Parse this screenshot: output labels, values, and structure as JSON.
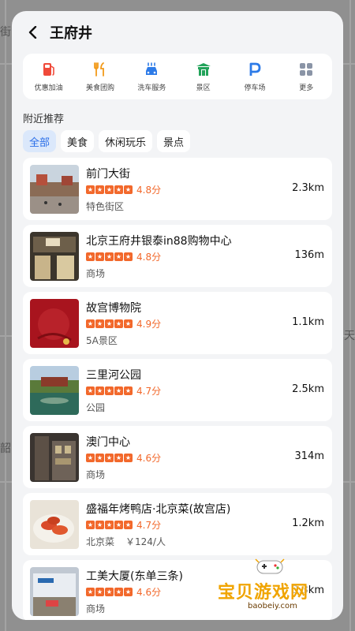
{
  "header": {
    "title": "王府井"
  },
  "services": [
    {
      "label": "优惠加油",
      "icon": "gas-station-icon"
    },
    {
      "label": "美食团购",
      "icon": "utensils-icon"
    },
    {
      "label": "洗车服务",
      "icon": "car-wash-icon"
    },
    {
      "label": "景区",
      "icon": "scenic-gate-icon"
    },
    {
      "label": "停车场",
      "icon": "parking-icon"
    },
    {
      "label": "更多",
      "icon": "more-grid-icon"
    }
  ],
  "nearby": {
    "title": "附近推荐",
    "filters": [
      "全部",
      "美食",
      "休闲玩乐",
      "景点"
    ],
    "active_filter": "全部"
  },
  "places": [
    {
      "name": "前门大街",
      "rating_text": "4.8分",
      "rating": 4.8,
      "category": "特色街区",
      "distance": "2.3km"
    },
    {
      "name": "北京王府井银泰in88购物中心",
      "rating_text": "4.8分",
      "rating": 4.8,
      "category": "商场",
      "distance": "136m"
    },
    {
      "name": "故宫博物院",
      "rating_text": "4.9分",
      "rating": 4.9,
      "category": "5A景区",
      "distance": "1.1km"
    },
    {
      "name": "三里河公园",
      "rating_text": "4.7分",
      "rating": 4.7,
      "category": "公园",
      "distance": "2.5km"
    },
    {
      "name": "澳门中心",
      "rating_text": "4.6分",
      "rating": 4.6,
      "category": "商场",
      "distance": "314m"
    },
    {
      "name": "盛福年烤鸭店·北京菜(故宫店)",
      "rating_text": "4.7分",
      "rating": 4.7,
      "category": "北京菜",
      "price": "￥124/人",
      "distance": "1.2km"
    },
    {
      "name": "工美大厦(东单三条)",
      "rating_text": "4.6分",
      "rating": 4.6,
      "category": "商场",
      "distance": "3.3km"
    }
  ],
  "colors": {
    "accent": "#2a6ee8",
    "rating": "#f2682b",
    "active_chip_bg": "#dbe8fb"
  },
  "watermark": {
    "text": "宝贝游戏网",
    "url": "baobeiy.com"
  }
}
